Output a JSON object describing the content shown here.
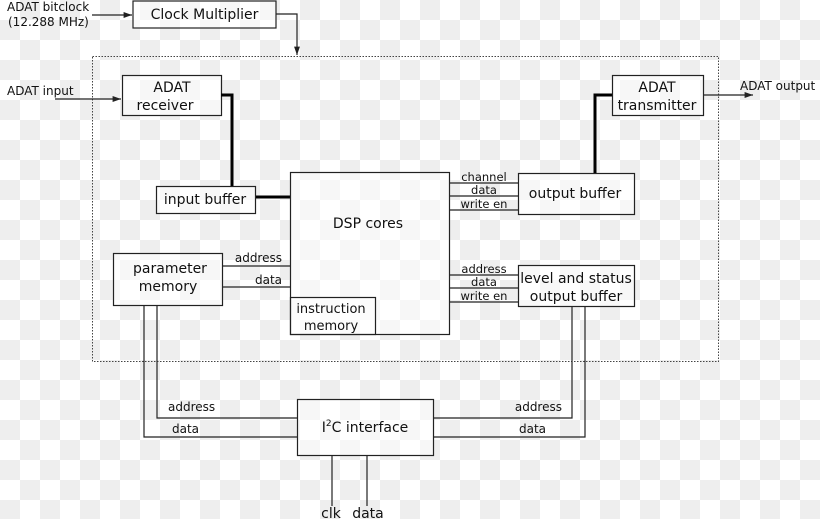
{
  "diagram": {
    "inputs": {
      "bitclock_line1": "ADAT bitclock",
      "bitclock_line2": "(12.288 MHz)",
      "adat_input": "ADAT input",
      "adat_output": "ADAT output"
    },
    "blocks": {
      "clock_multiplier": "Clock Multiplier",
      "adat_receiver_line1": "ADAT",
      "adat_receiver_line2": "receiver",
      "adat_transmitter_line1": "ADAT",
      "adat_transmitter_line2": "transmitter",
      "input_buffer": "input buffer",
      "dsp_cores": "DSP cores",
      "instruction_memory_line1": "instruction",
      "instruction_memory_line2": "memory",
      "parameter_memory_line1": "parameter",
      "parameter_memory_line2": "memory",
      "output_buffer": "output buffer",
      "level_status_line1": "level and status",
      "level_status_line2": "output buffer",
      "i2c_prefix": "I",
      "i2c_sup": "2",
      "i2c_suffix": "C interface"
    },
    "signals": {
      "param_address": "address",
      "param_data": "data",
      "out_channel": "channel",
      "out_data": "data",
      "out_write_en": "write en",
      "lvl_address": "address",
      "lvl_data": "data",
      "lvl_write_en": "write en",
      "i2c_left_address": "address",
      "i2c_left_data": "data",
      "i2c_right_address": "address",
      "i2c_right_data": "data",
      "i2c_clk": "clk",
      "i2c_data": "data"
    }
  }
}
